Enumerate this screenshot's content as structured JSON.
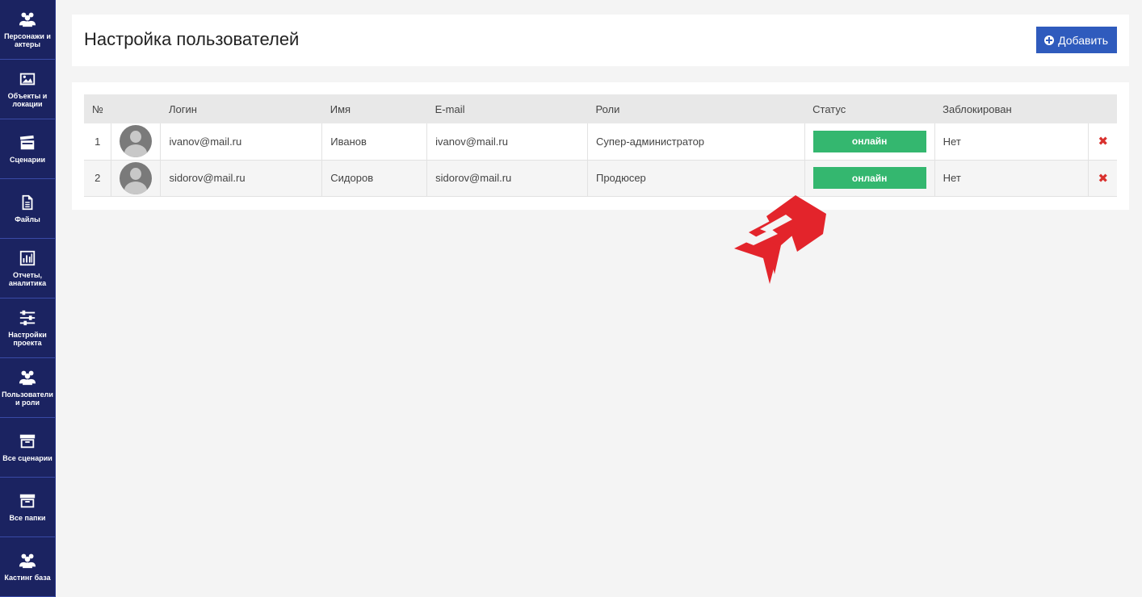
{
  "sidebar": {
    "items": [
      {
        "label": "Персонажи и актеры",
        "icon": "users-icon"
      },
      {
        "label": "Объекты и локации",
        "icon": "image-icon"
      },
      {
        "label": "Сценарии",
        "icon": "clapperboard-icon"
      },
      {
        "label": "Файлы",
        "icon": "file-icon"
      },
      {
        "label": "Отчеты, аналитика",
        "icon": "bar-chart-icon"
      },
      {
        "label": "Настройки проекта",
        "icon": "sliders-icon"
      },
      {
        "label": "Пользователи и роли",
        "icon": "users-icon"
      },
      {
        "label": "Все сценарии",
        "icon": "archive-icon"
      },
      {
        "label": "Все папки",
        "icon": "archive-icon"
      },
      {
        "label": "Кастинг база",
        "icon": "users-icon"
      }
    ]
  },
  "header": {
    "title": "Настройка пользователей",
    "add_label": "Добавить"
  },
  "table": {
    "columns": [
      "№",
      "",
      "Логин",
      "Имя",
      "E-mail",
      "Роли",
      "Статус",
      "Заблокирован",
      ""
    ],
    "rows": [
      {
        "num": "1",
        "login": "ivanov@mail.ru",
        "name": "Иванов",
        "email": "ivanov@mail.ru",
        "role": "Супер-администратор",
        "status": "онлайн",
        "blocked": "Нет"
      },
      {
        "num": "2",
        "login": "sidorov@mail.ru",
        "name": "Сидоров",
        "email": "sidorov@mail.ru",
        "role": "Продюсер",
        "status": "онлайн",
        "blocked": "Нет"
      }
    ]
  },
  "colors": {
    "sidebar_bg": "#1b2361",
    "accent": "#2f5bbd",
    "status_online": "#34b76f",
    "delete": "#d9312e",
    "decoration": "#e3242b"
  }
}
